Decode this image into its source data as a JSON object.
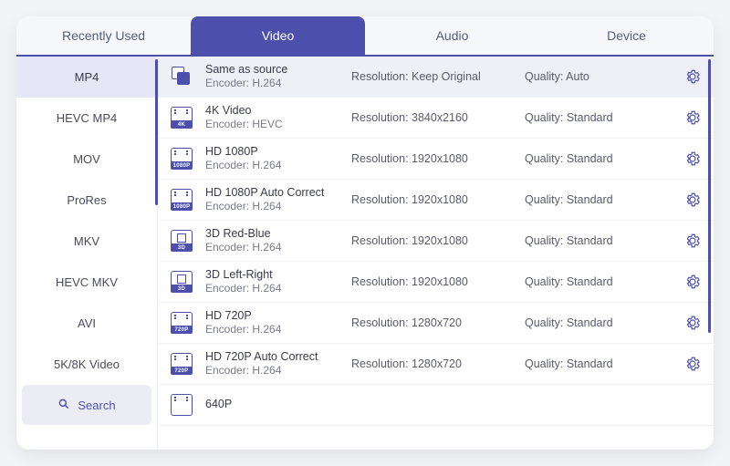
{
  "tabs": [
    {
      "label": "Recently Used",
      "active": false
    },
    {
      "label": "Video",
      "active": true
    },
    {
      "label": "Audio",
      "active": false
    },
    {
      "label": "Device",
      "active": false
    }
  ],
  "formats": [
    {
      "label": "MP4",
      "active": true
    },
    {
      "label": "HEVC MP4",
      "active": false
    },
    {
      "label": "MOV",
      "active": false
    },
    {
      "label": "ProRes",
      "active": false
    },
    {
      "label": "MKV",
      "active": false
    },
    {
      "label": "HEVC MKV",
      "active": false
    },
    {
      "label": "AVI",
      "active": false
    },
    {
      "label": "5K/8K Video",
      "active": false
    }
  ],
  "search_label": "Search",
  "resolution_prefix": "Resolution: ",
  "quality_prefix": "Quality: ",
  "encoder_prefix": "Encoder: ",
  "presets": [
    {
      "title": "Same as source",
      "encoder": "H.264",
      "resolution": "Keep Original",
      "quality": "Auto",
      "icon": "copy",
      "badge": "",
      "selected": true
    },
    {
      "title": "4K Video",
      "encoder": "HEVC",
      "resolution": "3840x2160",
      "quality": "Standard",
      "icon": "film",
      "badge": "4K",
      "selected": false
    },
    {
      "title": "HD 1080P",
      "encoder": "H.264",
      "resolution": "1920x1080",
      "quality": "Standard",
      "icon": "film",
      "badge": "1080P",
      "selected": false
    },
    {
      "title": "HD 1080P Auto Correct",
      "encoder": "H.264",
      "resolution": "1920x1080",
      "quality": "Standard",
      "icon": "film",
      "badge": "1080P",
      "selected": false
    },
    {
      "title": "3D Red-Blue",
      "encoder": "H.264",
      "resolution": "1920x1080",
      "quality": "Standard",
      "icon": "cube",
      "badge": "3D",
      "selected": false
    },
    {
      "title": "3D Left-Right",
      "encoder": "H.264",
      "resolution": "1920x1080",
      "quality": "Standard",
      "icon": "cube",
      "badge": "3D",
      "selected": false
    },
    {
      "title": "HD 720P",
      "encoder": "H.264",
      "resolution": "1280x720",
      "quality": "Standard",
      "icon": "film",
      "badge": "720P",
      "selected": false
    },
    {
      "title": "HD 720P Auto Correct",
      "encoder": "H.264",
      "resolution": "1280x720",
      "quality": "Standard",
      "icon": "film",
      "badge": "720P",
      "selected": false
    },
    {
      "title": "640P",
      "encoder": "",
      "resolution": "",
      "quality": "",
      "icon": "film",
      "badge": "",
      "selected": false,
      "partial": true
    }
  ],
  "colors": {
    "accent": "#4c50ac"
  }
}
